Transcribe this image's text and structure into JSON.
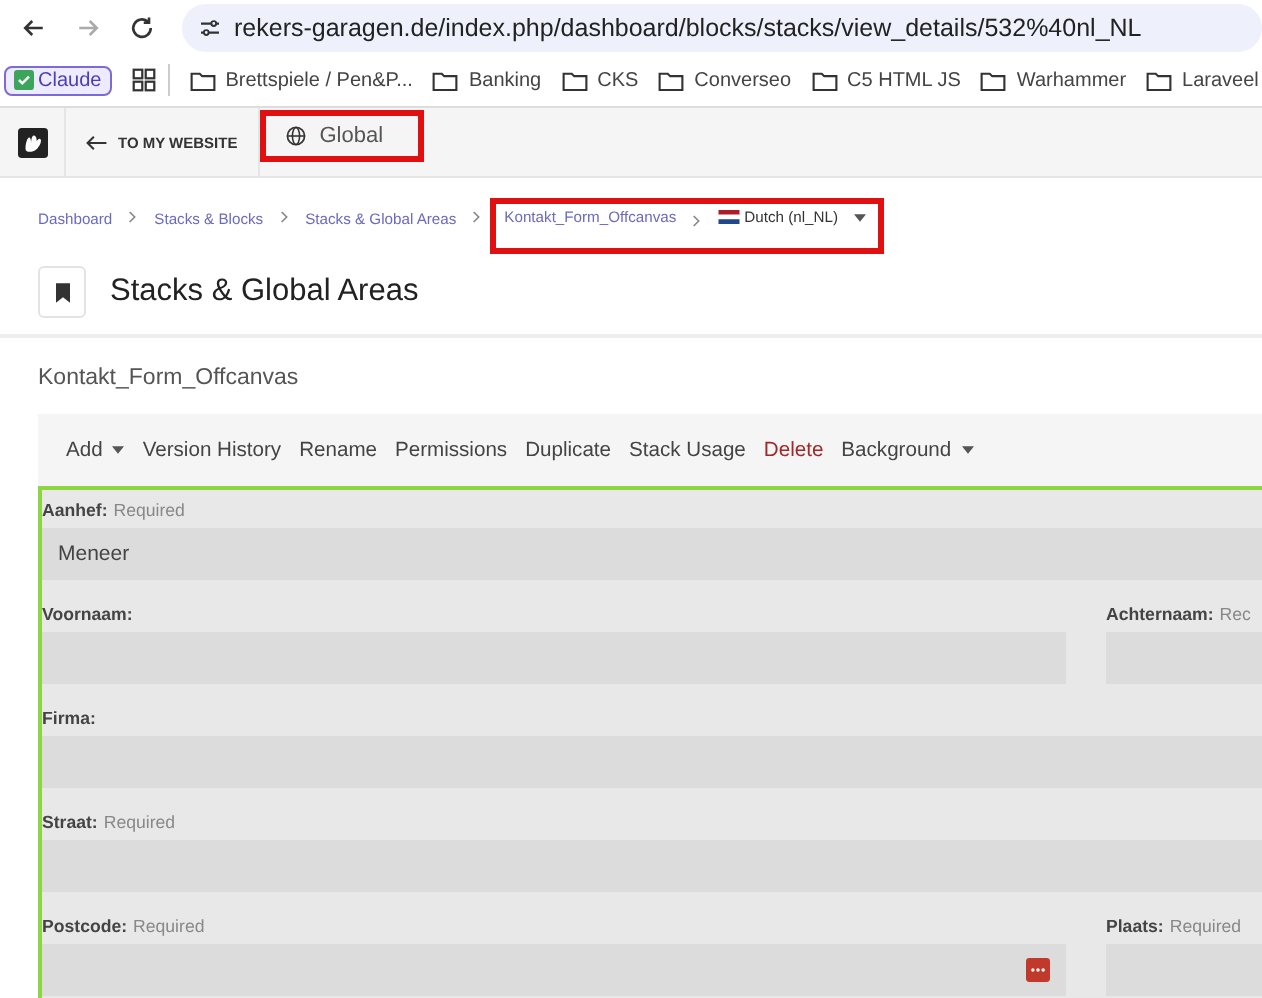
{
  "browser": {
    "url": "rekers-garagen.de/index.php/dashboard/blocks/stacks/view_details/532%40nl_NL",
    "bookmarks": [
      {
        "label": "Claude",
        "kind": "chip"
      },
      {
        "kind": "apps"
      },
      {
        "label": "Brettspiele / Pen&P...",
        "kind": "folder"
      },
      {
        "label": "Banking",
        "kind": "folder"
      },
      {
        "label": "CKS",
        "kind": "folder"
      },
      {
        "label": "Converseo",
        "kind": "folder"
      },
      {
        "label": "C5 HTML JS",
        "kind": "folder"
      },
      {
        "label": "Warhammer",
        "kind": "folder"
      },
      {
        "label": "Laraveel",
        "kind": "folder"
      }
    ]
  },
  "toolbar": {
    "back_link": "TO MY WEBSITE",
    "site": "Global"
  },
  "breadcrumb": [
    "Dashboard",
    "Stacks & Blocks",
    "Stacks & Global Areas",
    "Kontakt_Form_Offcanvas"
  ],
  "language": "Dutch (nl_NL)",
  "page_title": "Stacks & Global Areas",
  "stack_name": "Kontakt_Form_Offcanvas",
  "menu": [
    {
      "label": "Add",
      "kind": "dropdown"
    },
    {
      "label": "Version History",
      "kind": "plain"
    },
    {
      "label": "Rename",
      "kind": "plain"
    },
    {
      "label": "Permissions",
      "kind": "plain"
    },
    {
      "label": "Duplicate",
      "kind": "plain"
    },
    {
      "label": "Stack Usage",
      "kind": "plain"
    },
    {
      "label": "Delete",
      "kind": "danger"
    },
    {
      "label": "Background",
      "kind": "dropdown"
    }
  ],
  "form_rows": [
    {
      "fields": [
        {
          "label": "Aanhef:",
          "hint": "Required",
          "value": "Meneer"
        }
      ]
    },
    {
      "fields": [
        {
          "label": "Voornaam:"
        },
        {
          "label": "Achternaam:",
          "hint": "Rec"
        }
      ]
    },
    {
      "fields": [
        {
          "label": "Firma:"
        }
      ]
    },
    {
      "fields": [
        {
          "label": "Straat:",
          "hint": "Required"
        }
      ]
    },
    {
      "fields": [
        {
          "label": "Postcode:",
          "hint": "Required",
          "password_icon": true
        },
        {
          "label": "Plaats:",
          "hint": "Required"
        }
      ]
    }
  ]
}
